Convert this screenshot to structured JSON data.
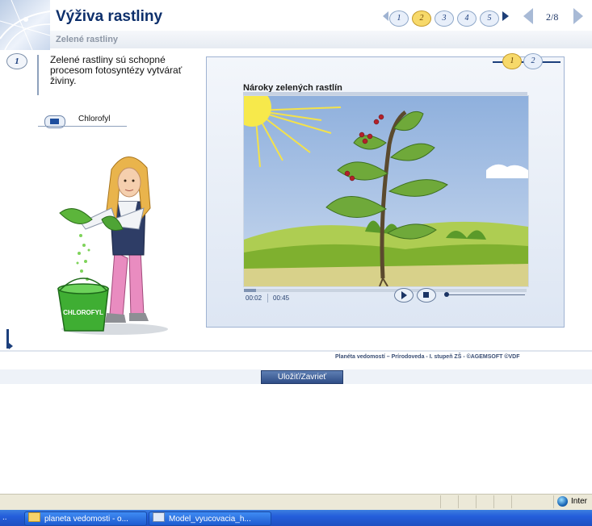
{
  "header": {
    "title": "Výživa rastliny",
    "subtitle": "Zelené rastliny",
    "pagination": [
      "1",
      "2",
      "3",
      "4",
      "5"
    ],
    "active_page": "2",
    "page_counter": "2/8"
  },
  "lesson": {
    "step": "1",
    "intro_text": "Zelené rastliny sú schopné procesom fotosyntézy vytvárať živiny.",
    "link_label": "Chlorofyl"
  },
  "illustration": {
    "bucket_label": "CHLOROFYL"
  },
  "media": {
    "tabs": [
      "1",
      "2"
    ],
    "active_tab": "1",
    "title": "Nároky zelených rastlín",
    "time_current": "00:02",
    "time_total": "00:45",
    "progress": 0.044
  },
  "footer": {
    "copyright": "Planéta vedomostí – Prírodoveda - I. stupeň ZŠ - ©AGEMSOFT ©VDF",
    "save_label": "Uložiť/Zavrieť"
  },
  "statusbar": {
    "zone": "Inter"
  },
  "taskbar": {
    "dots": "..",
    "items": [
      "planeta vedomosti - o...",
      "Model_vyucovacia_h..."
    ]
  },
  "colors": {
    "title": "#0d2f6b",
    "accent": "#1c3f7c",
    "active_bubble": "#f7d96a",
    "taskbar": "#245edb"
  }
}
